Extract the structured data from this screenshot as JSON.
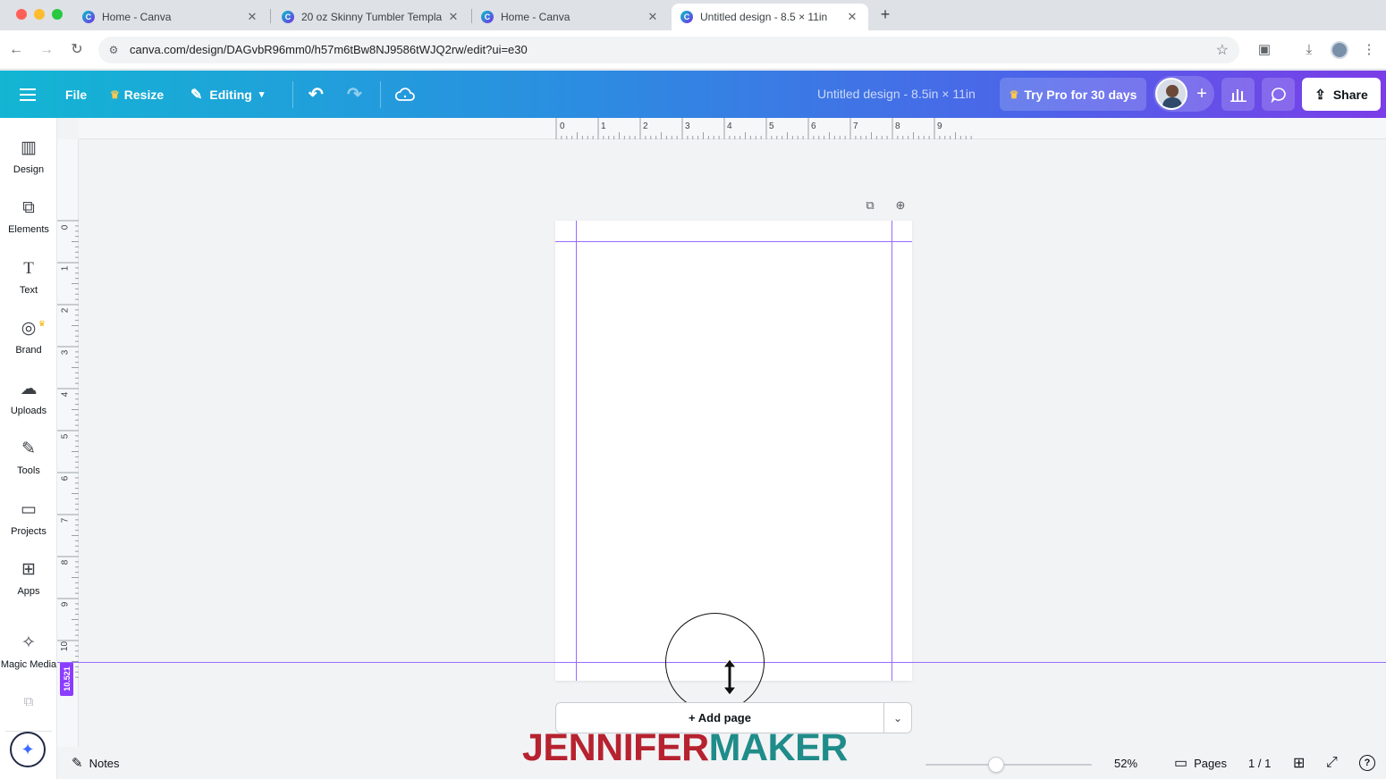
{
  "browser": {
    "tabs": [
      {
        "label": "Home - Canva",
        "active": false
      },
      {
        "label": "20 oz Skinny Tumbler Templa",
        "active": false
      },
      {
        "label": "Home - Canva",
        "active": false
      },
      {
        "label": "Untitled design - 8.5 × 11in",
        "active": true
      }
    ],
    "url": "canva.com/design/DAGvbR96mm0/h57m6tBw8NJ9586tWJQ2rw/edit?ui=e30"
  },
  "topbar": {
    "file_label": "File",
    "resize_label": "Resize",
    "editing_label": "Editing",
    "design_title": "Untitled design - 8.5in × 11in",
    "pro_label": "Try Pro for 30 days",
    "share_label": "Share"
  },
  "sidebar": {
    "items": [
      {
        "label": "Design",
        "icon": "design-icon"
      },
      {
        "label": "Elements",
        "icon": "elements-icon"
      },
      {
        "label": "Text",
        "icon": "text-icon"
      },
      {
        "label": "Brand",
        "icon": "brand-icon"
      },
      {
        "label": "Uploads",
        "icon": "uploads-icon"
      },
      {
        "label": "Tools",
        "icon": "tools-icon"
      },
      {
        "label": "Projects",
        "icon": "projects-icon"
      },
      {
        "label": "Apps",
        "icon": "apps-icon"
      },
      {
        "label": "Magic Media",
        "icon": "magic-media-icon"
      }
    ]
  },
  "rulers": {
    "top": [
      "0",
      "1",
      "2",
      "3",
      "4",
      "5",
      "6",
      "7",
      "8",
      "9"
    ],
    "left": [
      "0",
      "1",
      "2",
      "3",
      "4",
      "5",
      "6",
      "7",
      "8",
      "9",
      "10"
    ],
    "guide_readout": "10.521"
  },
  "canvas": {
    "add_page_label": "+ Add page"
  },
  "bottombar": {
    "notes_label": "Notes",
    "zoom_value": "52%",
    "pages_label": "Pages",
    "page_count": "1 / 1"
  },
  "watermark": {
    "part1": "JENNIFER",
    "part2": "MAKER"
  },
  "colors": {
    "brand_gradient_start": "#13b5d3",
    "brand_gradient_end": "#7b3de8",
    "guide": "#9b6bff",
    "watermark_red": "#b6222f",
    "watermark_teal": "#1f8c8a"
  }
}
